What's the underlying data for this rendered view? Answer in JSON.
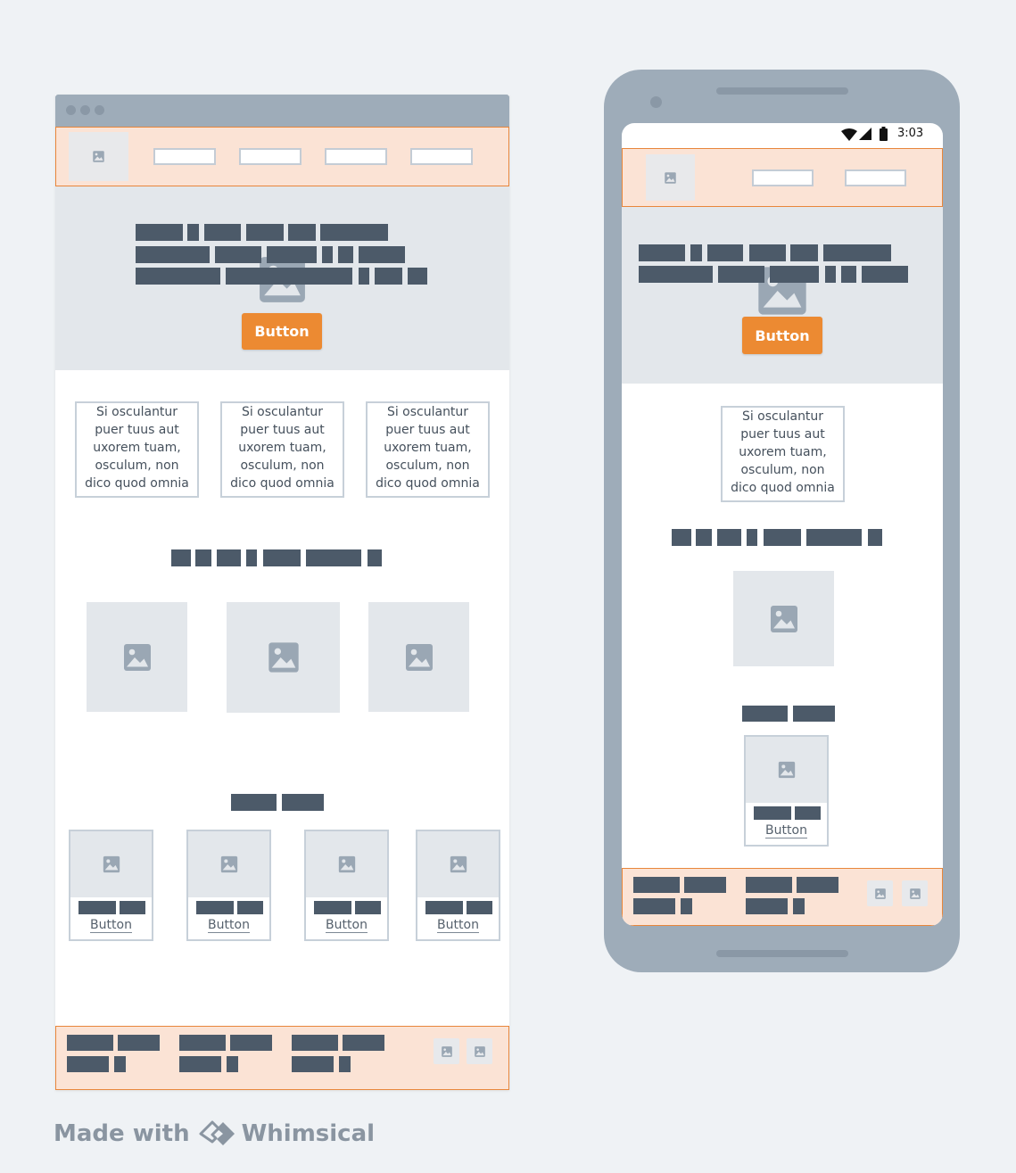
{
  "colors": {
    "page_bg": "#eff2f5",
    "frame_gray": "#9eacb9",
    "hero_bg": "#e3e7eb",
    "accent_orange": "#ec8a32",
    "nav_highlight": "#fbe3d5",
    "text_block": "#4c5a69"
  },
  "desktop": {
    "hero": {
      "button_label": "Button",
      "image_icon": "image-icon"
    },
    "feature_cards": [
      {
        "text": "Si osculantur puer tuus aut uxorem tuam, osculum, non dico quod omnia"
      },
      {
        "text": "Si osculantur puer tuus aut uxorem tuam, osculum, non dico quod omnia"
      },
      {
        "text": "Si osculantur puer tuus aut uxorem tuam, osculum, non dico quod omnia"
      }
    ],
    "products": [
      {
        "button_label": "Button"
      },
      {
        "button_label": "Button"
      },
      {
        "button_label": "Button"
      },
      {
        "button_label": "Button"
      }
    ]
  },
  "mobile": {
    "status_bar": {
      "time": "3:03",
      "icons": [
        "wifi-icon",
        "signal-icon",
        "battery-icon"
      ]
    },
    "hero": {
      "button_label": "Button"
    },
    "feature_card": {
      "text": "Si osculantur puer tuus aut uxorem tuam, osculum, non dico quod omnia"
    },
    "product": {
      "button_label": "Button"
    }
  },
  "branding": {
    "made_with": "Made with",
    "brand_name": "Whimsical",
    "logo_icon": "whimsical-logo-icon"
  }
}
